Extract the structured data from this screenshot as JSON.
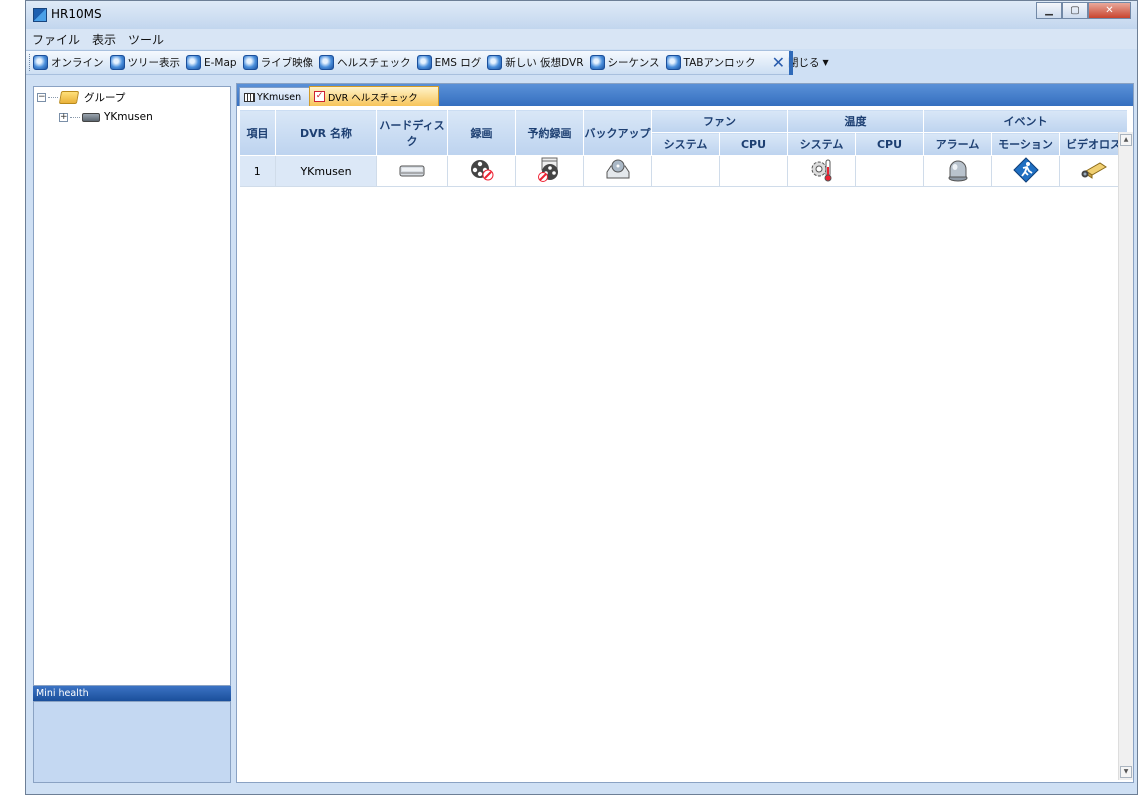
{
  "window": {
    "title": "HR10MS"
  },
  "menu": [
    "ファイル",
    "表示",
    "ツール"
  ],
  "toolbar": {
    "items": [
      {
        "label": "オンライン",
        "icon": "online-icon"
      },
      {
        "label": "ツリー表示",
        "icon": "tree-view-icon"
      },
      {
        "label": "E-Map",
        "icon": "emap-icon"
      },
      {
        "label": "ライブ映像",
        "icon": "live-video-icon"
      },
      {
        "label": "ヘルスチェック",
        "icon": "health-check-icon"
      },
      {
        "label": "EMS ログ",
        "icon": "ems-log-icon"
      },
      {
        "label": "新しい 仮想DVR",
        "icon": "new-virtual-dvr-icon"
      },
      {
        "label": "シーケンス",
        "icon": "sequence-icon"
      },
      {
        "label": "TABアンロック",
        "icon": "tab-unlock-icon"
      }
    ],
    "close_label": "閉じる"
  },
  "tree": {
    "root_label": "グループ",
    "child_label": "YKmusen"
  },
  "mini_health": {
    "title": "Mini health"
  },
  "tabs": [
    {
      "label": "YKmusen",
      "icon": "grid-icon"
    },
    {
      "label": "DVR ヘルスチェック",
      "icon": "check-icon"
    }
  ],
  "table": {
    "headers": {
      "item": "項目",
      "dvr_name": "DVR 名称",
      "hdd": "ハードディスク",
      "record": "録画",
      "scheduled": "予約録画",
      "backup": "バックアップ",
      "fan": "ファン",
      "temp": "温度",
      "event": "イベント",
      "fan_system": "システム",
      "fan_cpu": "CPU",
      "temp_system": "システム",
      "temp_cpu": "CPU",
      "alarm": "アラーム",
      "motion": "モーション",
      "video_loss": "ビデオロス"
    },
    "rows": [
      {
        "item": "1",
        "dvr_name": "YKmusen",
        "icons": {
          "hdd": "hard-disk-icon",
          "record": "record-disabled-icon",
          "scheduled": "schedule-record-disabled-icon",
          "backup": "backup-icon",
          "temp_system": "temperature-icon",
          "alarm": "alarm-icon",
          "motion": "motion-icon",
          "video_loss": "video-loss-camera-icon"
        }
      }
    ]
  }
}
